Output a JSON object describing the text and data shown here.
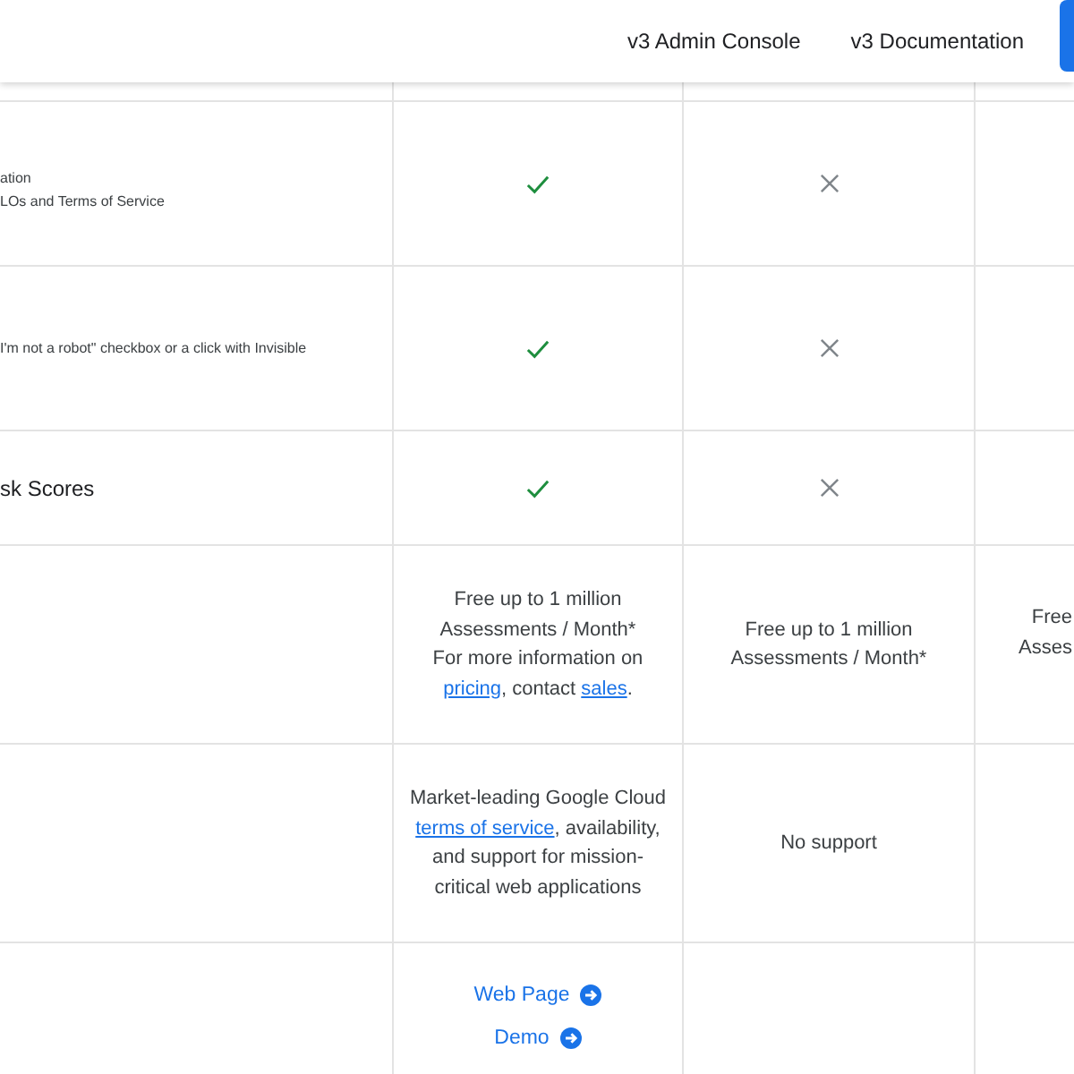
{
  "header": {
    "links": [
      "v3 Admin Console",
      "v3 Documentation"
    ]
  },
  "rows": [
    {
      "label": {
        "kind": "small",
        "lines": [
          "ation",
          "LOs and Terms of Service"
        ]
      },
      "cells": [
        {
          "kind": "check"
        },
        {
          "kind": "cross"
        },
        {
          "kind": "empty"
        }
      ]
    },
    {
      "label": {
        "kind": "small",
        "lines": [
          "I'm not a robot\" checkbox or a click with Invisible"
        ]
      },
      "cells": [
        {
          "kind": "check"
        },
        {
          "kind": "cross"
        },
        {
          "kind": "empty"
        }
      ]
    },
    {
      "label": {
        "kind": "large",
        "lines": [
          "sk Scores"
        ]
      },
      "cells": [
        {
          "kind": "check"
        },
        {
          "kind": "cross"
        },
        {
          "kind": "empty"
        }
      ]
    },
    {
      "cells": [
        {
          "kind": "text",
          "lines": [
            [
              {
                "text": "Free up to 1 million"
              }
            ],
            [
              {
                "text": "Assessments / Month*"
              }
            ],
            [
              {
                "text": "For more information on"
              }
            ],
            [
              {
                "link": "pricing"
              },
              {
                "text": ", contact "
              },
              {
                "link": "sales"
              },
              {
                "text": "."
              }
            ]
          ]
        },
        {
          "kind": "text",
          "lines": [
            [
              {
                "text": "Free up to 1 million"
              }
            ],
            [
              {
                "text": "Assessments / Month*"
              }
            ]
          ]
        },
        {
          "kind": "clipped",
          "lines": [
            "Free",
            "Asses"
          ]
        }
      ]
    },
    {
      "cells": [
        {
          "kind": "text",
          "lines": [
            [
              {
                "text": "Market-leading Google Cloud"
              }
            ],
            [
              {
                "link": "terms of service"
              },
              {
                "text": ", availability,"
              }
            ],
            [
              {
                "text": "and support for mission-"
              }
            ],
            [
              {
                "text": "critical web applications"
              }
            ]
          ]
        },
        {
          "kind": "text",
          "lines": [
            [
              {
                "text": "No support"
              }
            ]
          ]
        },
        {
          "kind": "empty"
        }
      ]
    },
    {
      "cells": [
        {
          "kind": "links",
          "items": [
            "Web Page",
            "Demo"
          ]
        },
        {
          "kind": "empty"
        },
        {
          "kind": "empty"
        }
      ]
    }
  ]
}
